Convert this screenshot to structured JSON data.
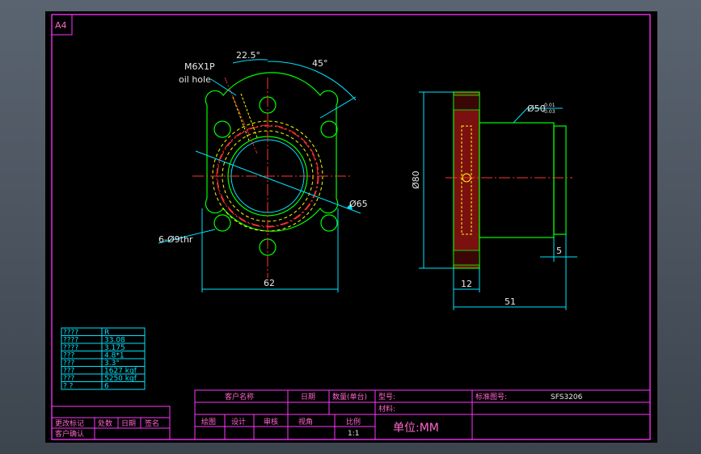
{
  "sheet": {
    "size_label": "A4"
  },
  "annotations": {
    "oil_hole_thread": "M6X1P",
    "oil_hole_label": "oil hole",
    "angle_small": "22.5°",
    "angle_large": "45°",
    "diam_pitch": "Ø65",
    "holes": "6-Ø9thr",
    "width": "62",
    "flange_height": "Ø80",
    "body_diam": "Ø50",
    "body_tol_upper": "-0.01",
    "body_tol_lower": "-0.03",
    "flange_thk": "12",
    "length": "51",
    "chamfer": "5"
  },
  "spec_table": {
    "rows": [
      {
        "key": "????",
        "value": "R"
      },
      {
        "key": "????",
        "value": "33.08"
      },
      {
        "key": "????",
        "value": "3.175"
      },
      {
        "key": "???",
        "value": "4.8*1"
      },
      {
        "key": "???",
        "value": "3.3°"
      },
      {
        "key": "???",
        "value": "1627 kgf"
      },
      {
        "key": "???",
        "value": "5250 kgf"
      },
      {
        "key": "?  ?",
        "value": "6"
      }
    ]
  },
  "title_block": {
    "customer_name": "客户名称",
    "date": "日期",
    "quantity": "数量(单台)",
    "model_label": "型号:",
    "drawing_no_label": "标准图号:",
    "drawing_no": "SFS3206",
    "material": "材料:",
    "drawn": "绘图",
    "design": "设计",
    "review": "审核",
    "view_angle": "视角",
    "scale_label": "比例",
    "scale": "1:1",
    "unit": "单位:MM",
    "revision": "更改标记",
    "location": "处数",
    "rev_date": "日期",
    "signature": "签名",
    "customer_confirm": "客户确认"
  }
}
